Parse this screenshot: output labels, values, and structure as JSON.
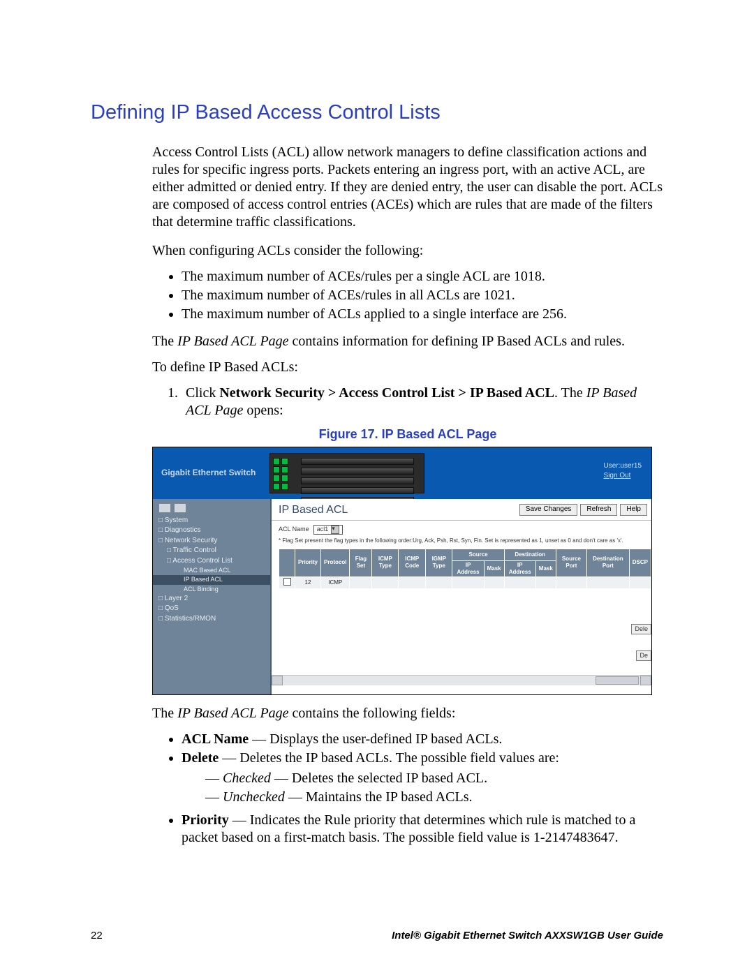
{
  "heading": "Defining IP Based Access Control Lists",
  "intro_p1": "Access Control Lists (ACL) allow network managers to define classification actions and rules for specific ingress ports. Packets entering an ingress port, with an active ACL, are either admitted or denied entry. If they are denied entry, the user can disable the port. ACLs are composed of access control entries (ACEs) which are rules that are made of the filters that determine traffic classifications.",
  "intro_p2": "When configuring ACLs consider the following:",
  "bullets1": [
    "The maximum number of ACEs/rules per a single ACL are 1018.",
    "The maximum number of ACEs/rules in all ACLs are 1021.",
    "The maximum number of ACLs applied to a single interface are 256."
  ],
  "p_after_bullets_pre": "The ",
  "p_after_bullets_page": "IP Based ACL Page",
  "p_after_bullets_post": " contains information for defining IP Based ACLs and rules.",
  "p_define": "To define IP Based ACLs:",
  "step1_pre": "Click ",
  "step1_bold": "Network Security > Access Control List > IP Based ACL",
  "step1_mid": ". The ",
  "step1_italic": "IP Based ACL Page",
  "step1_post": " opens:",
  "figure_caption": "Figure 17. IP Based ACL Page",
  "shot": {
    "brand": "Gigabit Ethernet Switch",
    "user_label": "User:user15",
    "sign_out": "Sign Out",
    "sidebar": {
      "items": [
        {
          "label": "System",
          "lvl": "l1",
          "sq": true
        },
        {
          "label": "Diagnostics",
          "lvl": "l1",
          "sq": true
        },
        {
          "label": "Network Security",
          "lvl": "l1",
          "sq": true
        },
        {
          "label": "Traffic Control",
          "lvl": "l2",
          "sq": true
        },
        {
          "label": "Access Control List",
          "lvl": "l2",
          "sq": true
        },
        {
          "label": "MAC Based ACL",
          "lvl": "l4"
        },
        {
          "label": "IP Based ACL",
          "lvl": "l4",
          "sel": true
        },
        {
          "label": "ACL Binding",
          "lvl": "l4"
        },
        {
          "label": "Layer 2",
          "lvl": "l1",
          "sq": true
        },
        {
          "label": "QoS",
          "lvl": "l1",
          "sq": true
        },
        {
          "label": "Statistics/RMON",
          "lvl": "l1",
          "sq": true
        }
      ]
    },
    "main": {
      "title": "IP Based ACL",
      "btn_save": "Save Changes",
      "btn_refresh": "Refresh",
      "btn_help": "Help",
      "acl_name_label": "ACL Name",
      "acl_name_value": "acl1",
      "flag_note": "* Flag Set present the flag types in the following order:Urg, Ack, Psh, Rst, Syn, Fin. Set is represented as 1, unset as 0 and don't care as 'x'.",
      "headers": {
        "blank": "",
        "priority": "Priority",
        "protocol": "Protocol",
        "flag_set": "Flag Set",
        "icmp_type": "ICMP Type",
        "icmp_code": "ICMP Code",
        "igmp_type": "IGMP Type",
        "source": "Source",
        "destination": "Destination",
        "source_port": "Source Port",
        "dest_port": "Destination Port",
        "dscp": "DSCP",
        "ip_addr": "IP Address",
        "mask": "Mask"
      },
      "row": {
        "priority": "12",
        "protocol": "ICMP"
      },
      "btn_delete": "Dele",
      "btn_de": "De"
    }
  },
  "p_fields_pre": "The ",
  "p_fields_page": "IP Based ACL Page",
  "p_fields_post": " contains the following fields:",
  "fields": {
    "acl_name": {
      "label": "ACL Name",
      "desc": " — Displays the user-defined IP based ACLs."
    },
    "delete": {
      "label": "Delete",
      "desc": " — Deletes the IP based ACLs. The possible field values are:"
    },
    "delete_sub": {
      "checked": {
        "label": "Checked",
        "desc": " — Deletes the selected IP based ACL."
      },
      "unchecked": {
        "label": "Unchecked",
        "desc": " — Maintains the IP based ACLs."
      }
    },
    "priority": {
      "label": "Priority",
      "desc": " — Indicates the Rule priority that determines which rule is matched to a packet based on a first-match basis. The possible field value is 1-2147483647."
    }
  },
  "footer": {
    "page": "22",
    "doc": "Intel® Gigabit Ethernet Switch AXXSW1GB User Guide"
  }
}
